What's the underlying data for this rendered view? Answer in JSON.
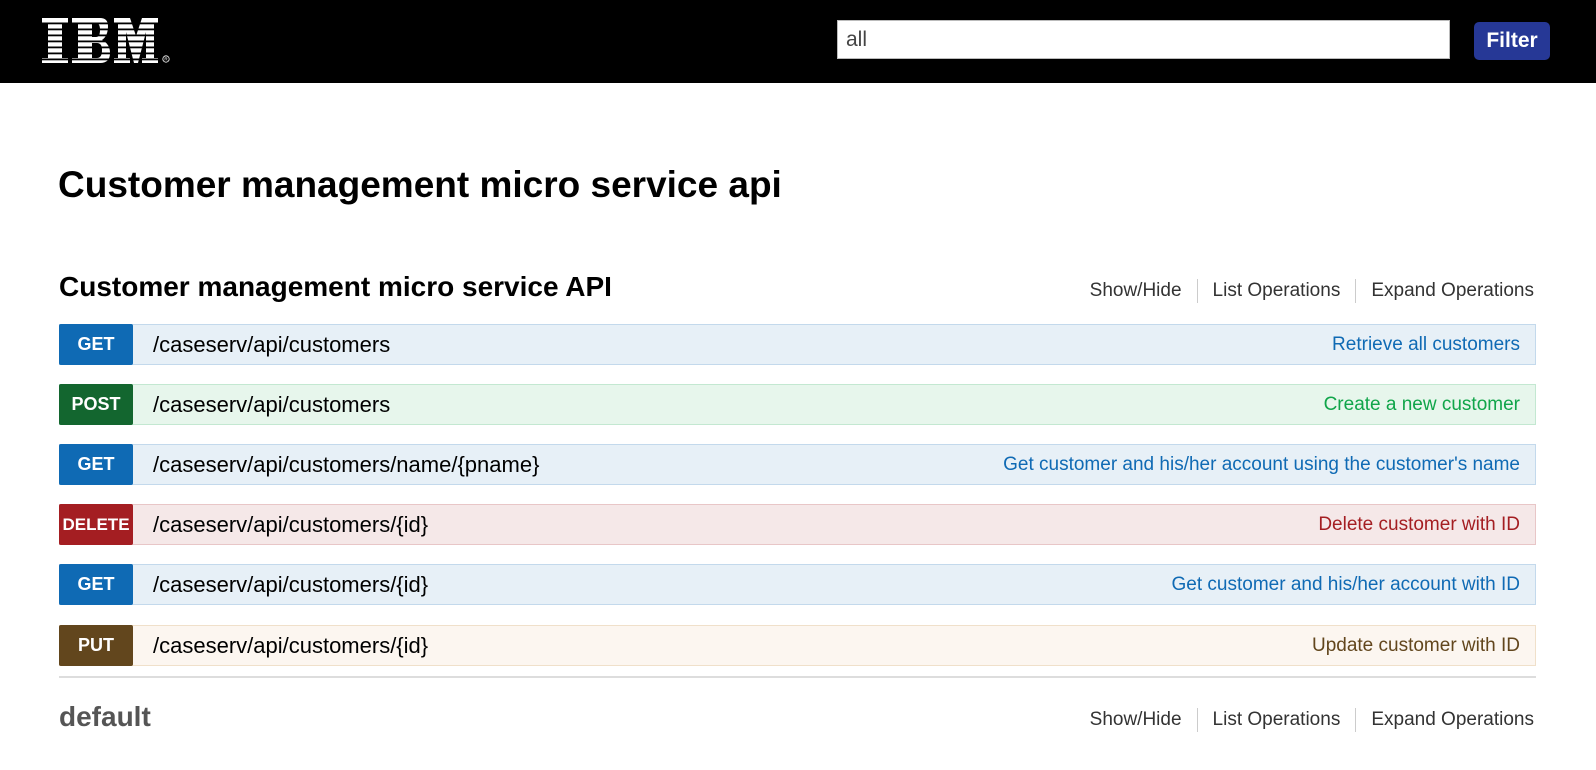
{
  "header": {
    "logo_text": "IBM",
    "filter_value": "all",
    "filter_button_label": "Filter"
  },
  "page_title": "Customer management micro service api",
  "resources": [
    {
      "title": "Customer management micro service API",
      "links": [
        "Show/Hide",
        "List Operations",
        "Expand Operations"
      ],
      "operations": [
        {
          "method": "GET",
          "path": "/caseserv/api/customers",
          "summary": "Retrieve all customers"
        },
        {
          "method": "POST",
          "path": "/caseserv/api/customers",
          "summary": "Create a new customer"
        },
        {
          "method": "GET",
          "path": "/caseserv/api/customers/name/{pname}",
          "summary": "Get customer and his/her account using the customer's name"
        },
        {
          "method": "DELETE",
          "path": "/caseserv/api/customers/{id}",
          "summary": "Delete customer with ID"
        },
        {
          "method": "GET",
          "path": "/caseserv/api/customers/{id}",
          "summary": "Get customer and his/her account with ID"
        },
        {
          "method": "PUT",
          "path": "/caseserv/api/customers/{id}",
          "summary": "Update customer with ID"
        }
      ]
    },
    {
      "title": "default",
      "links": [
        "Show/Hide",
        "List Operations",
        "Expand Operations"
      ],
      "operations": []
    }
  ],
  "colors": {
    "get": "#0f6ab4",
    "post": "#13662f",
    "delete": "#a41e22",
    "put": "#62461d",
    "filter_button": "#263896"
  }
}
